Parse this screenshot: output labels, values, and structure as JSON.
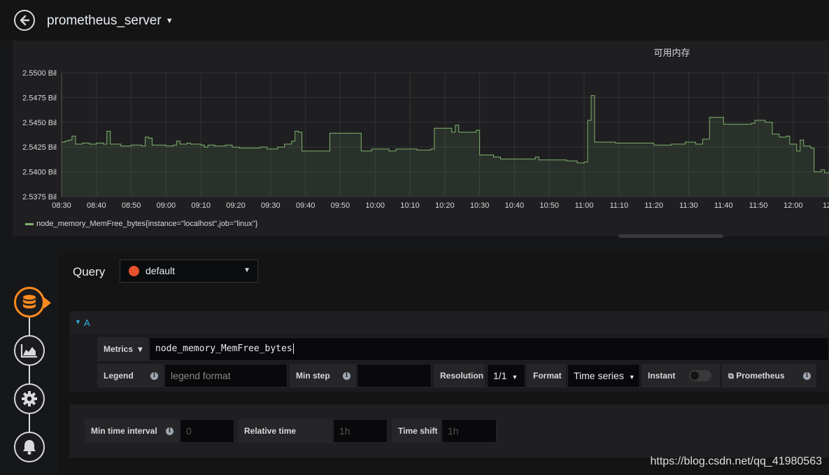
{
  "header": {
    "title": "prometheus_server"
  },
  "panel": {
    "title": "可用内存",
    "legend": "node_memory_MemFree_bytes{instance=\"localhost\",job=\"linux\"}"
  },
  "chart_data": {
    "type": "line",
    "title": "可用内存",
    "xlabel": "",
    "ylabel": "",
    "ylim": [
      2.5375,
      2.55
    ],
    "y_unit": "Bil",
    "y_ticks": [
      "2.5500 Bil",
      "2.5475 Bil",
      "2.5450 Bil",
      "2.5425 Bil",
      "2.5400 Bil",
      "2.5375 Bil"
    ],
    "x_ticks": [
      "08:30",
      "08:40",
      "08:50",
      "09:00",
      "09:10",
      "09:20",
      "09:30",
      "09:40",
      "09:50",
      "10:00",
      "10:10",
      "10:20",
      "10:30",
      "10:40",
      "10:50",
      "11:00",
      "11:10",
      "11:20",
      "11:30",
      "11:40",
      "11:50",
      "12:00",
      "12:"
    ],
    "grid": true,
    "fill": true,
    "legend_position": "bottom-left",
    "series": [
      {
        "name": "node_memory_MemFree_bytes{instance=\"localhost\",job=\"linux\"}",
        "color": "#7eb26d",
        "points": [
          [
            "08:30",
            2.543
          ],
          [
            "08:31",
            2.5431
          ],
          [
            "08:32",
            2.5432
          ],
          [
            "08:33",
            2.5436
          ],
          [
            "08:34",
            2.5428
          ],
          [
            "08:36",
            2.5429
          ],
          [
            "08:38",
            2.5428
          ],
          [
            "08:40",
            2.5429
          ],
          [
            "08:42",
            2.5428
          ],
          [
            "08:43",
            2.5441
          ],
          [
            "08:44",
            2.5428
          ],
          [
            "08:47",
            2.5426
          ],
          [
            "08:50",
            2.5427
          ],
          [
            "08:53",
            2.5426
          ],
          [
            "08:54",
            2.5435
          ],
          [
            "08:55",
            2.5434
          ],
          [
            "08:56",
            2.5427
          ],
          [
            "09:00",
            2.5426
          ],
          [
            "09:02",
            2.5427
          ],
          [
            "09:03",
            2.5431
          ],
          [
            "09:04",
            2.5428
          ],
          [
            "09:06",
            2.5429
          ],
          [
            "09:07",
            2.5428
          ],
          [
            "09:10",
            2.5427
          ],
          [
            "09:11",
            2.5425
          ],
          [
            "09:12",
            2.5427
          ],
          [
            "09:14",
            2.5426
          ],
          [
            "09:17",
            2.5427
          ],
          [
            "09:19",
            2.5425
          ],
          [
            "09:21",
            2.5424
          ],
          [
            "09:25",
            2.5424
          ],
          [
            "09:27",
            2.5425
          ],
          [
            "09:29",
            2.5423
          ],
          [
            "09:32",
            2.5425
          ],
          [
            "09:34",
            2.5428
          ],
          [
            "09:36",
            2.5431
          ],
          [
            "09:37",
            2.5441
          ],
          [
            "09:38",
            2.544
          ],
          [
            "09:39",
            2.5421
          ],
          [
            "09:43",
            2.5421
          ],
          [
            "09:47",
            2.5439
          ],
          [
            "09:55",
            2.5439
          ],
          [
            "09:56",
            2.5421
          ],
          [
            "09:59",
            2.5423
          ],
          [
            "10:03",
            2.5423
          ],
          [
            "10:04",
            2.5421
          ],
          [
            "10:06",
            2.5423
          ],
          [
            "10:10",
            2.5423
          ],
          [
            "10:12",
            2.5422
          ],
          [
            "10:16",
            2.5423
          ],
          [
            "10:17",
            2.5444
          ],
          [
            "10:21",
            2.5444
          ],
          [
            "10:22",
            2.544
          ],
          [
            "10:23",
            2.5447
          ],
          [
            "10:24",
            2.544
          ],
          [
            "10:29",
            2.5442
          ],
          [
            "10:30",
            2.5417
          ],
          [
            "10:34",
            2.5415
          ],
          [
            "10:36",
            2.5413
          ],
          [
            "10:44",
            2.5413
          ],
          [
            "10:46",
            2.5415
          ],
          [
            "10:47",
            2.5412
          ],
          [
            "10:55",
            2.5411
          ],
          [
            "10:58",
            2.5409
          ],
          [
            "11:00",
            2.541
          ],
          [
            "11:01",
            2.5452
          ],
          [
            "11:02",
            2.5477
          ],
          [
            "11:03",
            2.543
          ],
          [
            "11:09",
            2.5429
          ],
          [
            "11:14",
            2.5429
          ],
          [
            "11:20",
            2.5427
          ],
          [
            "11:25",
            2.5428
          ],
          [
            "11:29",
            2.543
          ],
          [
            "11:32",
            2.5428
          ],
          [
            "11:34",
            2.5433
          ],
          [
            "11:36",
            2.5455
          ],
          [
            "11:39",
            2.5455
          ],
          [
            "11:40",
            2.5448
          ],
          [
            "11:48",
            2.5449
          ],
          [
            "11:49",
            2.5452
          ],
          [
            "11:52",
            2.545
          ],
          [
            "11:54",
            2.5438
          ],
          [
            "11:56",
            2.5435
          ],
          [
            "11:58",
            2.5436
          ],
          [
            "11:59",
            2.5428
          ],
          [
            "12:00",
            2.5428
          ],
          [
            "12:01",
            2.5421
          ],
          [
            "12:02",
            2.5432
          ],
          [
            "12:03",
            2.5426
          ],
          [
            "12:05",
            2.5424
          ],
          [
            "12:06",
            2.54
          ],
          [
            "12:08",
            2.5402
          ],
          [
            "12:09",
            2.5399
          ]
        ]
      }
    ]
  },
  "steps": [
    "database-icon",
    "chart-area-icon",
    "gear-icon",
    "bell-icon"
  ],
  "query": {
    "label": "Query",
    "datasource": "default",
    "row_letter": "A",
    "metrics_label": "Metrics",
    "metrics_caret": "▾",
    "metrics_value": "node_memory_MemFree_bytes",
    "legend_label": "Legend",
    "legend_placeholder": "legend format",
    "min_step_label": "Min step",
    "min_step_value": "",
    "resolution_label": "Resolution",
    "resolution_value": "1/1",
    "format_label": "Format",
    "format_value": "Time series",
    "instant_label": "Instant",
    "instant_on": false,
    "prometheus_link": "Prometheus"
  },
  "options": {
    "min_time_interval_label": "Min time interval",
    "min_time_interval_placeholder": "0",
    "relative_time_label": "Relative time",
    "relative_time_placeholder": "1h",
    "time_shift_label": "Time shift",
    "time_shift_placeholder": "1h"
  },
  "watermark": "https://blog.csdn.net/qq_41980563"
}
